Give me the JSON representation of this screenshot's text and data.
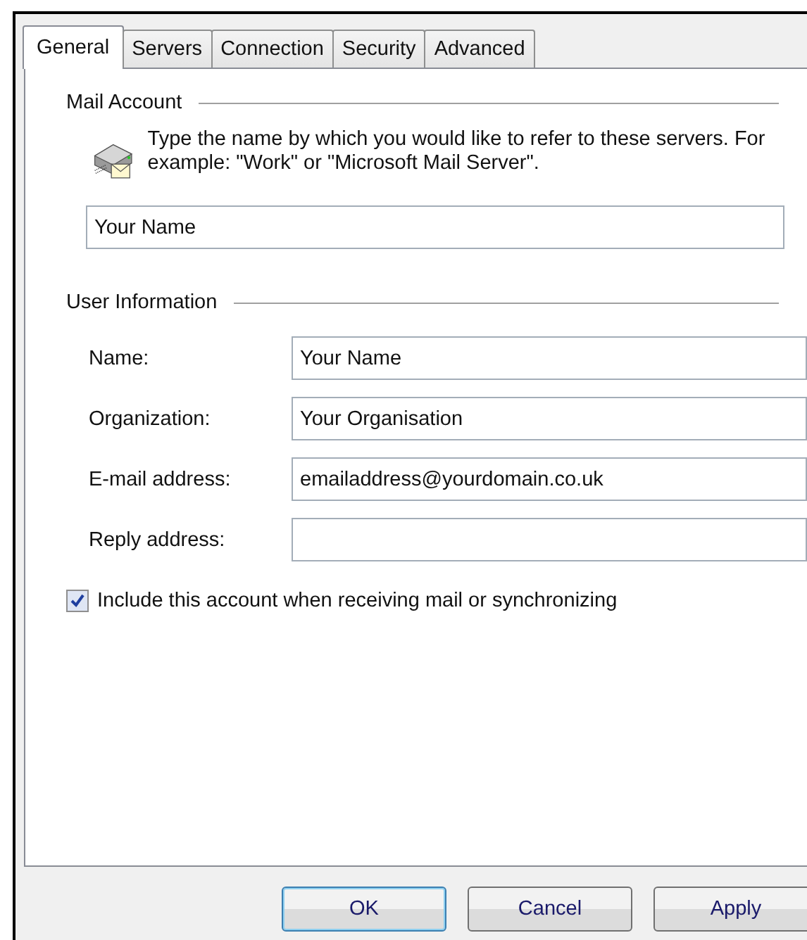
{
  "tabs": [
    {
      "label": "General",
      "selected": true
    },
    {
      "label": "Servers",
      "selected": false
    },
    {
      "label": "Connection",
      "selected": false
    },
    {
      "label": "Security",
      "selected": false
    },
    {
      "label": "Advanced",
      "selected": false
    }
  ],
  "mail_account": {
    "title": "Mail Account",
    "description": "Type the name by which you would like to refer to these servers.  For example: \"Work\" or \"Microsoft Mail Server\".",
    "value": "Your Name"
  },
  "user_information": {
    "title": "User Information",
    "fields": [
      {
        "label": "Name:",
        "value": "Your Name"
      },
      {
        "label": "Organization:",
        "value": "Your Organisation"
      },
      {
        "label": "E-mail address:",
        "value": "emailaddress@yourdomain.co.uk"
      },
      {
        "label": "Reply address:"
      }
    ]
  },
  "include_account": {
    "label": "Include this account when receiving mail or synchronizing",
    "checked": true
  },
  "buttons": [
    {
      "label": "OK",
      "default": true
    },
    {
      "label": "Cancel",
      "default": false
    },
    {
      "label": "Apply",
      "default": false
    }
  ]
}
